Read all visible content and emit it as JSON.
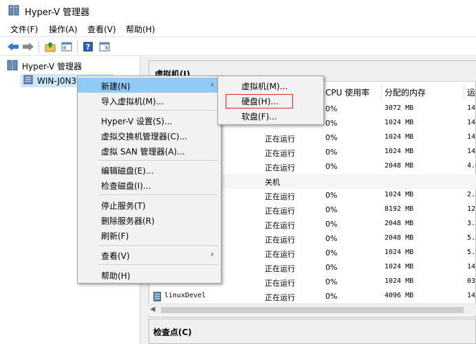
{
  "window": {
    "title": "Hyper-V 管理器"
  },
  "menubar": {
    "items": [
      "文件(F)",
      "操作(A)",
      "查看(V)",
      "帮助(H)"
    ]
  },
  "tree": {
    "root": "Hyper-V 管理器",
    "server": "WIN-J0N3"
  },
  "vm_panel": {
    "title": "虚拟机(I)",
    "columns": [
      "CPU 使用率",
      "分配的内存",
      "运行"
    ]
  },
  "vm_rows": [
    {
      "state": "",
      "cpu": "0%",
      "mem": "3072 MB",
      "uptime": "14."
    },
    {
      "state": "",
      "cpu": "0%",
      "mem": "1024 MB",
      "uptime": "14."
    },
    {
      "state": "正在运行",
      "cpu": "0%",
      "mem": "1024 MB",
      "uptime": "14."
    },
    {
      "state": "正在运行",
      "cpu": "0%",
      "mem": "1024 MB",
      "uptime": "14."
    },
    {
      "state": "正在运行",
      "cpu": "0%",
      "mem": "2048 MB",
      "uptime": "4.0"
    },
    {
      "state": "关机",
      "cpu": "",
      "mem": "",
      "uptime": ""
    },
    {
      "state": "正在运行",
      "cpu": "0%",
      "mem": "1024 MB",
      "uptime": "2.1"
    },
    {
      "state": "正在运行",
      "cpu": "0%",
      "mem": "8192 MB",
      "uptime": "12."
    },
    {
      "state": "正在运行",
      "cpu": "0%",
      "mem": "2048 MB",
      "uptime": "3.2"
    },
    {
      "state": "正在运行",
      "cpu": "0%",
      "mem": "2048 MB",
      "uptime": "5.2"
    },
    {
      "state": "正在运行",
      "cpu": "0%",
      "mem": "1024 MB",
      "uptime": "5.1"
    },
    {
      "state": "正在运行",
      "cpu": "0%",
      "mem": "1024 MB",
      "uptime": "14:"
    },
    {
      "state": "正在运行",
      "cpu": "0%",
      "mem": "1024 MB",
      "uptime": "03:"
    },
    {
      "name": "linuxDevel",
      "state": "正在运行",
      "cpu": "0%",
      "mem": "4096 MB",
      "uptime": "14."
    }
  ],
  "checkpoint_panel": {
    "title": "检查点(C)"
  },
  "context_menu": {
    "new": "新建(N)",
    "import": "导入虚拟机(M)...",
    "hv_settings": "Hyper-V 设置(S)...",
    "vswitch": "虚拟交换机管理器(C)...",
    "vsan": "虚拟 SAN 管理器(A)...",
    "edit_disk": "编辑磁盘(E)...",
    "inspect_disk": "检查磁盘(I)...",
    "stop_service": "停止服务(T)",
    "remove_server": "删除服务器(R)",
    "refresh": "刷新(F)",
    "view": "查看(V)",
    "help": "帮助(H)"
  },
  "submenu": {
    "vm": "虚拟机(M)...",
    "hdd": "硬盘(H)...",
    "floppy": "软盘(F)..."
  },
  "colors": {
    "highlight": "#91c9f7",
    "selection": "#cce8ff",
    "red_box": "#e02020"
  }
}
